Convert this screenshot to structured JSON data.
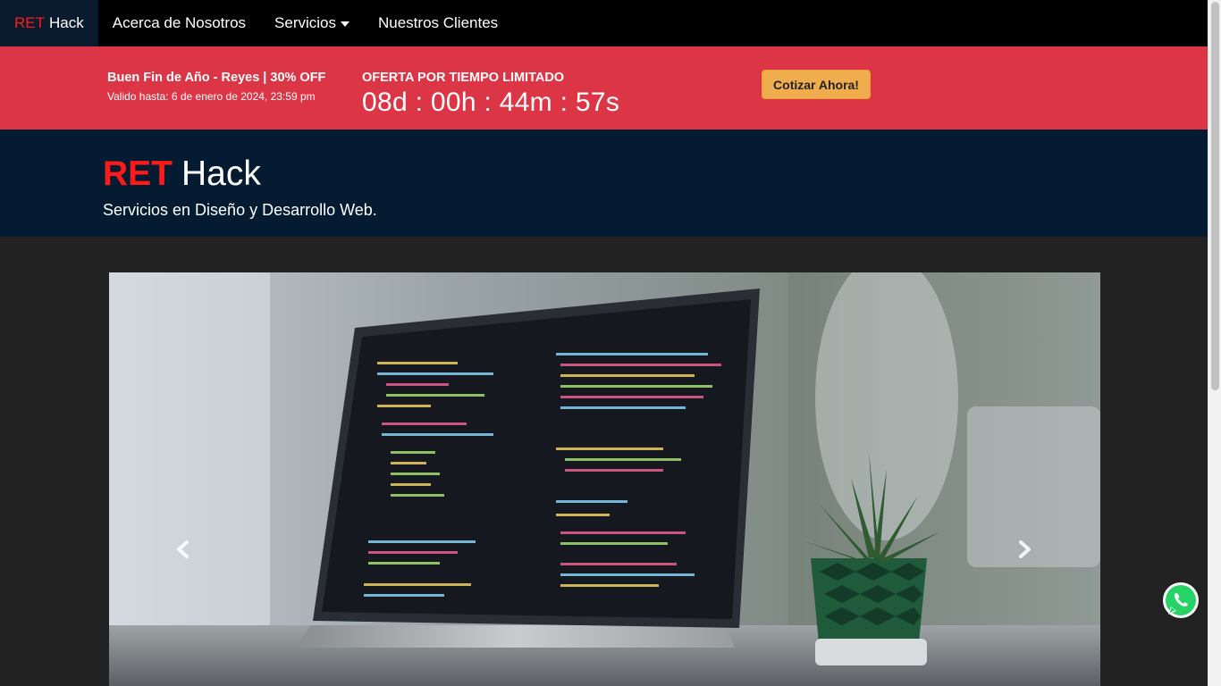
{
  "navbar": {
    "brand_red": "RET",
    "brand_white": "Hack",
    "items": [
      {
        "label": "Acerca de Nosotros"
      },
      {
        "label": "Servicios"
      },
      {
        "label": "Nuestros Clientes"
      }
    ]
  },
  "promo": {
    "title": "Buen Fin de Año - Reyes | 30% OFF",
    "valid_until": "Valido hasta: 6 de enero de 2024, 23:59 pm",
    "offer_label": "OFERTA POR TIEMPO LIMITADO",
    "countdown": "08d : 00h : 44m : 57s",
    "cta_label": "Cotizar Ahora!"
  },
  "hero": {
    "title_red": "RET",
    "title_white": "Hack",
    "subtitle": "Servicios en Diseño y Desarrollo Web."
  },
  "carousel": {
    "prev_icon": "chevron-left-icon",
    "next_icon": "chevron-right-icon"
  },
  "floating": {
    "whatsapp_icon": "whatsapp-icon"
  },
  "colors": {
    "navbar_bg": "#000000",
    "brand_bg": "#0a1b2e",
    "accent_red": "#ff1a1a",
    "promo_bg": "#dc3545",
    "cta_bg": "#f0ad4e",
    "hero_bg": "#051b31",
    "page_bg": "#222222",
    "whatsapp_green": "#25d366"
  }
}
